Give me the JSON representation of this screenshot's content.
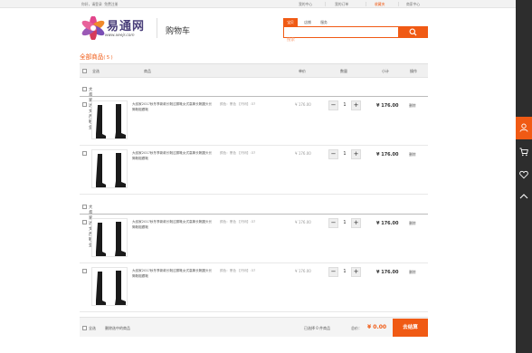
{
  "topbar": {
    "greeting": "你好，请登录",
    "register": "免费注册",
    "links": [
      "我的中心",
      "我的订单",
      "收藏夹",
      "商家中心"
    ],
    "cart_count": "0"
  },
  "logo": {
    "title": "易通网",
    "url": "www.xeejr.com"
  },
  "page_title": "购物车",
  "search": {
    "tabs": [
      "宝贝",
      "店铺",
      "服务"
    ],
    "placeholder": "搜索"
  },
  "cart": {
    "title": "全部商品",
    "count": "( 5 )",
    "columns": {
      "select_all": "全选",
      "goods": "商品",
      "unit_price": "单价",
      "quantity": "数量",
      "subtotal": "小计",
      "action": "操作"
    }
  },
  "shops": [
    {
      "name": "大叔家达文西鞋业",
      "items": [
        {
          "desc": "大叔家2017秋冬季新款长靴过膝靴女式高筒长靴圆头长筒靴粗跟靴",
          "spec": "颜色：黑色 【尺码】:37",
          "price": "¥ 176.00",
          "qty": "1",
          "subtotal": "¥ 176.00",
          "del": "删除"
        },
        {
          "desc": "大叔家2017秋冬季新款长靴过膝靴女式高筒长靴圆头长筒靴粗跟靴",
          "spec": "颜色：黑色 【尺码】:37",
          "price": "¥ 176.00",
          "qty": "1",
          "subtotal": "¥ 176.00",
          "del": "删除"
        }
      ]
    },
    {
      "name": "大叔家达文西鞋业",
      "items": [
        {
          "desc": "大叔家2017秋冬季新款长靴过膝靴女式高筒长靴圆头长筒靴粗跟靴",
          "spec": "颜色：黑色 【尺码】:37",
          "price": "¥ 176.00",
          "qty": "1",
          "subtotal": "¥ 176.00",
          "del": "删除"
        },
        {
          "desc": "大叔家2017秋冬季新款长靴过膝靴女式高筒长靴圆头长筒靴粗跟靴",
          "spec": "颜色：黑色 【尺码】:37",
          "price": "¥ 176.00",
          "qty": "1",
          "subtotal": "¥ 176.00",
          "del": "删除"
        }
      ]
    }
  ],
  "footer": {
    "select_all": "全选",
    "delete_selected": "删除选中的商品",
    "selected_text": "已选择 0 件商品",
    "total_label": "总价：",
    "total": "¥ 0.00",
    "checkout": "去结算"
  },
  "sidebar": {
    "icons": [
      "user-icon",
      "cart-icon",
      "heart-icon",
      "back-to-top-icon"
    ]
  },
  "colors": {
    "accent": "#f05a14",
    "sidebar": "#2d2d2d"
  }
}
